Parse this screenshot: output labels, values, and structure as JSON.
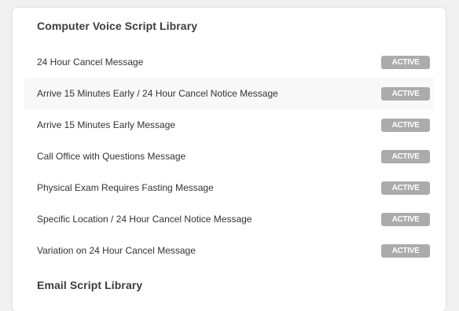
{
  "voice_library": {
    "title": "Computer Voice Script Library",
    "items": [
      {
        "label": "24 Hour Cancel Message",
        "status": "ACTIVE"
      },
      {
        "label": "Arrive 15 Minutes Early / 24 Hour Cancel Notice Message",
        "status": "ACTIVE"
      },
      {
        "label": "Arrive 15 Minutes Early Message",
        "status": "ACTIVE"
      },
      {
        "label": "Call Office with Questions Message",
        "status": "ACTIVE"
      },
      {
        "label": "Physical Exam Requires Fasting Message",
        "status": "ACTIVE"
      },
      {
        "label": "Specific Location / 24 Hour Cancel Notice Message",
        "status": "ACTIVE"
      },
      {
        "label": "Variation on 24 Hour Cancel Message",
        "status": "ACTIVE"
      }
    ]
  },
  "email_library": {
    "title": "Email Script Library"
  },
  "colors": {
    "badge_bg": "#ababab",
    "badge_text": "#ffffff",
    "alt_row_bg": "#f8f8f8"
  }
}
